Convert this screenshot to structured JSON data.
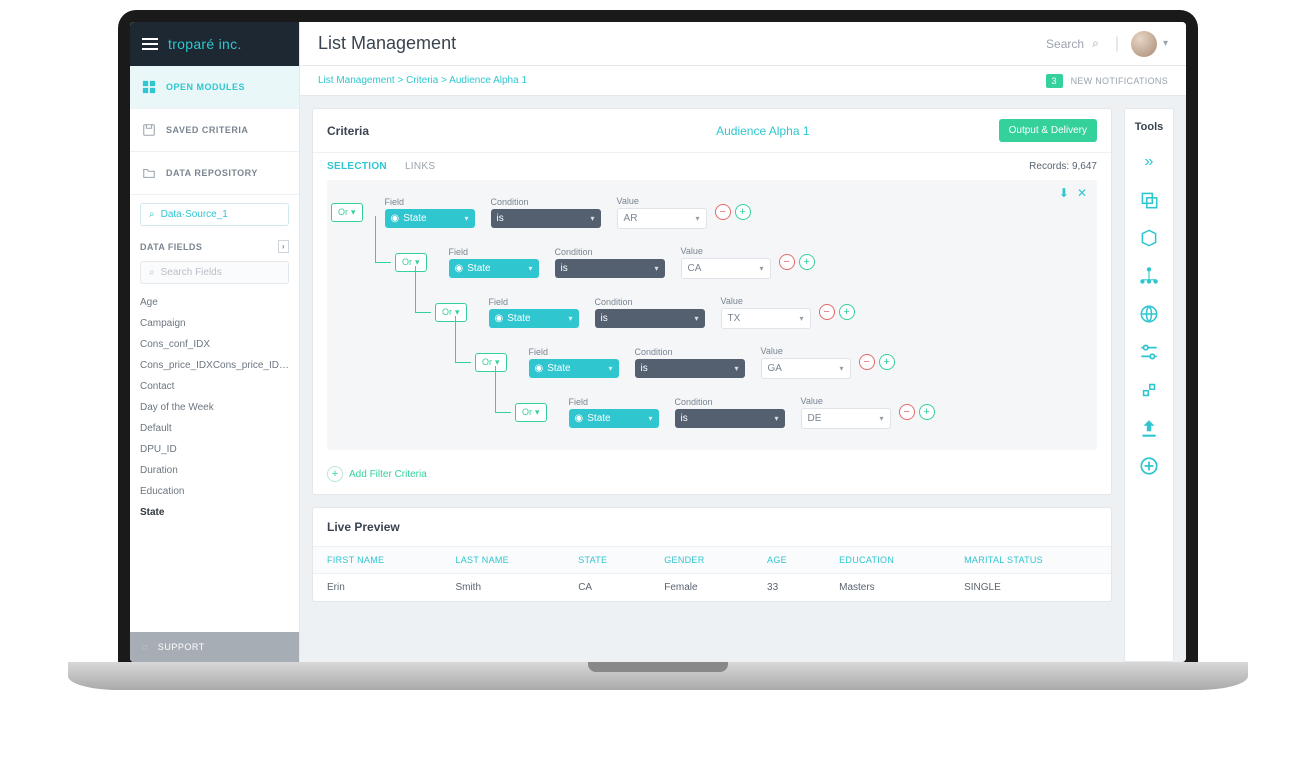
{
  "brand": "troparé inc.",
  "sidebar": {
    "open_modules": "OPEN MODULES",
    "saved_criteria": "SAVED CRITERIA",
    "data_repository": "DATA REPOSITORY",
    "datasource": "Data·Source_1",
    "data_fields_header": "DATA FIELDS",
    "search_placeholder": "Search Fields",
    "fields": [
      "Age",
      "Campaign",
      "Cons_conf_IDX",
      "Cons_price_IDXCons_price_IDX…",
      "Contact",
      "Day of the Week",
      "Default",
      "DPU_ID",
      "Duration",
      "Education",
      "State"
    ],
    "support": "SUPPORT"
  },
  "header": {
    "title": "List Management",
    "search": "Search",
    "breadcrumb": "List Management > Criteria > Audience Alpha 1",
    "notif_count": "3",
    "notif_label": "NEW NOTIFICATIONS"
  },
  "criteria": {
    "label": "Criteria",
    "audience": "Audience Alpha 1",
    "output_btn": "Output & Delivery",
    "tabs": {
      "selection": "SELECTION",
      "links": "LINKS"
    },
    "records_label": "Records: 9,647",
    "col_labels": {
      "field": "Field",
      "condition": "Condition",
      "value": "Value"
    },
    "or_label": "Or",
    "field_name": "State",
    "cond_name": "is",
    "rules": [
      {
        "value": "AR"
      },
      {
        "value": "CA"
      },
      {
        "value": "TX"
      },
      {
        "value": "GA"
      },
      {
        "value": "DE"
      }
    ],
    "add_filter": "Add Filter Criteria"
  },
  "preview": {
    "title": "Live Preview",
    "columns": [
      "FIRST NAME",
      "LAST NAME",
      "STATE",
      "GENDER",
      "AGE",
      "EDUCATION",
      "MARITAL STATUS"
    ],
    "rows": [
      [
        "Erin",
        "Smith",
        "CA",
        "Female",
        "33",
        "Masters",
        "SINGLE"
      ]
    ]
  },
  "tools": {
    "title": "Tools"
  }
}
